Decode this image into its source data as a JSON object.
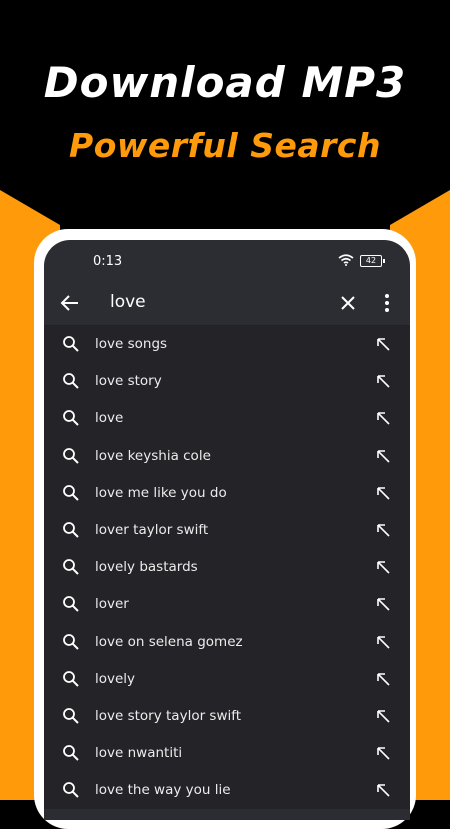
{
  "headline": {
    "title": "Download MP3",
    "subtitle": "Powerful Search"
  },
  "colors": {
    "accent": "#ff9a0a",
    "background": "#000000",
    "screen": "#2c2d33",
    "list": "#232328"
  },
  "status_bar": {
    "time": "0:13",
    "battery": "42"
  },
  "search": {
    "query": "love"
  },
  "suggestions": [
    {
      "label": "love songs"
    },
    {
      "label": "love story"
    },
    {
      "label": "love"
    },
    {
      "label": "love keyshia cole"
    },
    {
      "label": "love me like you do"
    },
    {
      "label": "lover taylor swift"
    },
    {
      "label": "lovely bastards"
    },
    {
      "label": "lover"
    },
    {
      "label": "love on selena gomez"
    },
    {
      "label": "lovely"
    },
    {
      "label": "love story taylor swift"
    },
    {
      "label": "love nwantiti"
    },
    {
      "label": "love the way you lie"
    }
  ]
}
